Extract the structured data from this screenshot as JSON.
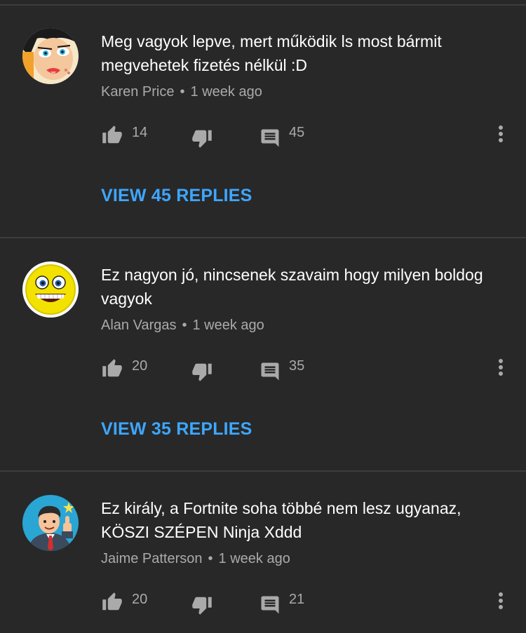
{
  "comments": [
    {
      "text": "Meg vagyok lepve, mert működik ls most bármit megvehetek fizetés nélkül :D",
      "author": "Karen Price",
      "separator": "•",
      "time": "1 week ago",
      "likes": "14",
      "replies_count": "45",
      "view_replies": "VIEW 45 REPLIES",
      "avatar": "comic-woman-avatar"
    },
    {
      "text": "Ez nagyon jó, nincsenek szavaim hogy milyen boldog vagyok",
      "author": "Alan Vargas",
      "separator": "•",
      "time": "1 week ago",
      "likes": "20",
      "replies_count": "35",
      "view_replies": "VIEW 35 REPLIES",
      "avatar": "grinning-face-avatar"
    },
    {
      "text": "Ez király, a Fortnite soha többé nem lesz ugyanaz, KÖSZI SZÉPEN Ninja Xddd",
      "author": "Jaime Patterson",
      "separator": "•",
      "time": "1 week ago",
      "likes": "20",
      "replies_count": "21",
      "avatar": "businessman-thumbs-up-avatar"
    }
  ],
  "colors": {
    "background": "#282828",
    "text": "#ffffff",
    "secondary": "#aaaaaa",
    "link": "#3ea6ff",
    "divider": "#3d3d3d"
  },
  "icons": [
    "thumbs-up-icon",
    "thumbs-down-icon",
    "reply-icon",
    "more-vert-icon"
  ]
}
